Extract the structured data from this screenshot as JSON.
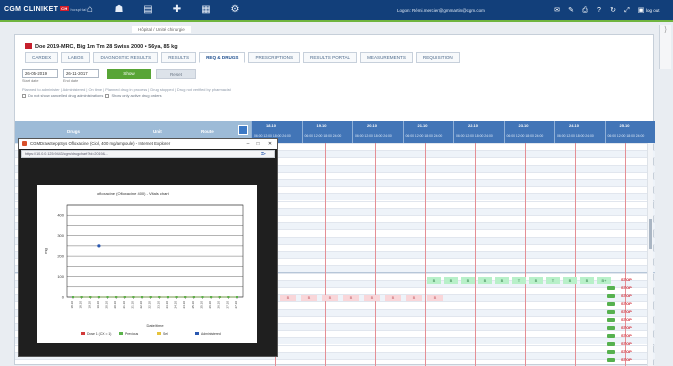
{
  "topbar": {
    "brand": "CGM CLINIKET",
    "brand_badge": "CH",
    "brand_sub": "hospital",
    "nav_icons": [
      "home-icon",
      "patients-icon",
      "documents-icon",
      "pharmacy-icon",
      "reports-icon",
      "settings-icon"
    ],
    "login_text": "Logon: Rémi.mercier@gmmartin@cgm.com",
    "right_icons": [
      "mail-icon",
      "notes-icon",
      "print-icon",
      "help-icon",
      "refresh-icon",
      "expand-icon",
      "lock-icon"
    ],
    "logout_label": "log out"
  },
  "breadcrumb": "Hôpital / Unité chirurgie",
  "patient": {
    "header": "Doe 2019-MRC, Big 1m Tm 28 Swiss 2000 • 56ya, 85 kg"
  },
  "tabs": [
    {
      "label": "CARDEX",
      "active": false
    },
    {
      "label": "LABOS",
      "active": false
    },
    {
      "label": "DIAGNOSTIC RESULTS",
      "active": false
    },
    {
      "label": "RESULTS",
      "active": false
    },
    {
      "label": "REQ & DRUGS",
      "active": true
    },
    {
      "label": "PRESCRIPTIONS",
      "active": false
    },
    {
      "label": "RESULTS PORTAL",
      "active": false
    },
    {
      "label": "MEASUREMENTS",
      "active": false
    },
    {
      "label": "REQUISITION",
      "active": false
    }
  ],
  "filters": {
    "from_value": "26-05-2019",
    "from_label": "Start date",
    "to_value": "26-11-2017",
    "to_label": "End date",
    "apply_label": "Show",
    "reset_label": "Reset"
  },
  "legend_text": "Planned to administer | Administered | On time | Planned drug in process | Drug stopped | Drug not verified by pharmacist",
  "checkbox1": "Do not show cancelled drug administrations",
  "checkbox2": "Show only active drug orders",
  "grid": {
    "col_drug": "Drugs",
    "col_unit": "Unit",
    "col_route": "Route",
    "days": [
      "18.10",
      "19.10",
      "20.10",
      "21.10",
      "22.10",
      "23.10",
      "24.10",
      "25.10"
    ],
    "times": "06:00 12:00 18:00 24:00",
    "dose_marks": [
      "B",
      "B",
      "B",
      "B",
      "B",
      "T",
      "B",
      "T",
      "B",
      "B",
      "B+"
    ],
    "pink_marks": [
      "B",
      "B",
      "B",
      "B",
      "B",
      "B",
      "B",
      "B"
    ],
    "stop_label": "STOP"
  },
  "popup": {
    "window_title": "CGMDrawSeppSys Ofloxacine (Ciol, 400 mg/ampoule) - Internet Explorer",
    "address": "https://10.0.0.125:9443/cgm/drugchart?id=2019&...",
    "chart_title": "ofloxacine (Ofloxacine 400) - Vitals chart"
  },
  "chart_data": {
    "type": "line",
    "title": "ofloxacine (Ofloxacine 400) - Vitals chart",
    "xlabel": "Date/time",
    "ylabel": "mg",
    "ylim": [
      0,
      450
    ],
    "grid": true,
    "x": [
      "18.10",
      "18.10",
      "19.10",
      "19.10",
      "20.10",
      "20.10",
      "21.10",
      "21.10",
      "22.10",
      "22.10",
      "23.10",
      "23.10",
      "24.10",
      "24.10",
      "25.10",
      "25.10",
      "26.10",
      "26.10",
      "27.10",
      "27.10"
    ],
    "series": [
      {
        "name": "Drug given",
        "color": "#2a58b0",
        "values": [
          null,
          null,
          null,
          null,
          null,
          null,
          null,
          null,
          null,
          null,
          null,
          null,
          null,
          null,
          null,
          null,
          null,
          null,
          null,
          null
        ],
        "point": {
          "x_index": 3,
          "y": 250
        }
      },
      {
        "name": "Planned",
        "color": "#d23a3a",
        "values": [
          0,
          0,
          0,
          0,
          0,
          0,
          0,
          0,
          0,
          0,
          0,
          0,
          0,
          0,
          0,
          0,
          0,
          0,
          0,
          0
        ]
      },
      {
        "name": "Prescribed",
        "color": "#5ab34a",
        "values": [
          0,
          0,
          0,
          0,
          0,
          0,
          0,
          0,
          0,
          0,
          0,
          0,
          0,
          0,
          0,
          0,
          0,
          0,
          0,
          0
        ]
      }
    ],
    "legend": [
      "Dose 1 (CX = 1)",
      "Previous",
      "Sel",
      "Administered"
    ],
    "legend_colors": [
      "#d23a3a",
      "#5ab34a",
      "#e6c33c",
      "#2a58b0"
    ]
  }
}
